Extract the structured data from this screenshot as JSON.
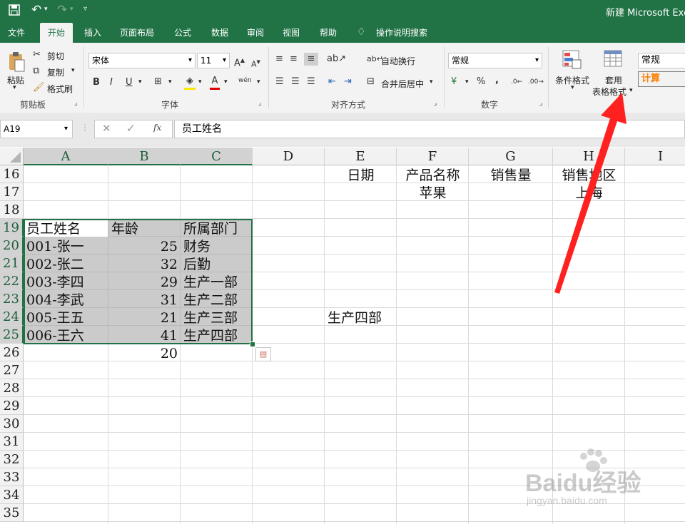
{
  "title_bar": {
    "title": "新建 Microsoft Exce"
  },
  "tabs": [
    "文件",
    "开始",
    "插入",
    "页面布局",
    "公式",
    "数据",
    "审阅",
    "视图",
    "帮助",
    "操作说明搜索"
  ],
  "active_tab": "开始",
  "ribbon": {
    "clipboard": {
      "paste": "粘贴",
      "cut": "剪切",
      "copy": "复制",
      "format_painter": "格式刷",
      "label": "剪贴板"
    },
    "font": {
      "name": "宋体",
      "size": "11",
      "bold": "B",
      "italic": "I",
      "underline": "U",
      "label": "字体",
      "phonetic": "wén"
    },
    "alignment": {
      "wrap": "自动换行",
      "merge": "合并后居中",
      "label": "对齐方式"
    },
    "number": {
      "format": "常规",
      "percent": "%",
      "comma": ",",
      "label": "数字"
    },
    "styles": {
      "conditional": "条件格式",
      "table_format_1": "套用",
      "table_format_2": "表格格式",
      "style_normal": "常规",
      "style_calc": "计算"
    }
  },
  "formula_bar": {
    "name_box": "A19",
    "content": "员工姓名",
    "fx": "fx"
  },
  "columns": [
    "A",
    "B",
    "C",
    "D",
    "E",
    "F",
    "G",
    "H",
    "I"
  ],
  "rows": [
    "16",
    "17",
    "18",
    "19",
    "20",
    "21",
    "22",
    "23",
    "24",
    "25",
    "26",
    "27",
    "28",
    "29",
    "30",
    "31",
    "32",
    "33",
    "34",
    "35"
  ],
  "cells": {
    "E16": "日期",
    "F16": "产品名称",
    "G16": "销售量",
    "H16": "销售地区",
    "F17": "苹果",
    "H17": "上海",
    "A19": "员工姓名",
    "B19": "年龄",
    "C19": "所属部门",
    "A20": "001-张一",
    "B20": "25",
    "C20": "财务",
    "A21": "002-张二",
    "B21": "32",
    "C21": "后勤",
    "A22": "003-李四",
    "B22": "29",
    "C22": "生产一部",
    "A23": "004-李武",
    "B23": "31",
    "C23": "生产二部",
    "E24": "生产四部",
    "A24": "005-王五",
    "B24": "21",
    "C24": "生产三部",
    "A25": "006-王六",
    "B25": "41",
    "C25": "生产四部",
    "B26": "20"
  },
  "watermark": {
    "brand": "Baidu经验",
    "url": "jingyan.baidu.com"
  },
  "colors": {
    "excel_green": "#217346",
    "selection_fill": "#c6c6c6",
    "arrow_red": "#ff2020"
  }
}
